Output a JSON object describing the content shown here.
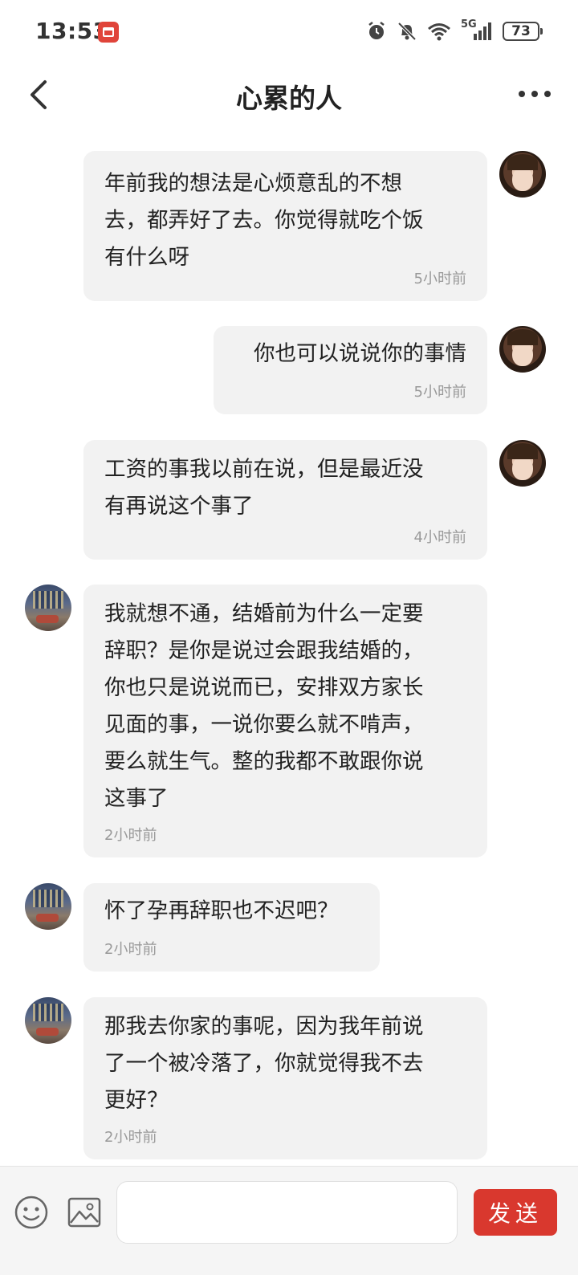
{
  "status_bar": {
    "time": "13:53",
    "network_label": "5G",
    "battery_level": "73",
    "icons": [
      "app-badge-icon",
      "alarm-icon",
      "mute-bell-icon",
      "wifi-icon",
      "signal-icon",
      "battery-icon"
    ]
  },
  "header": {
    "title": "心累的人",
    "back_icon": "chevron-left-icon",
    "more_icon": "more-dots-icon"
  },
  "messages": [
    {
      "sender": "me",
      "text": "年前我的想法是心烦意乱的不想\n去，都弄好了去。你觉得就吃个饭\n有什么呀",
      "time": "5小时前"
    },
    {
      "sender": "me",
      "text": "你也可以说说你的事情",
      "time": "5小时前"
    },
    {
      "sender": "me",
      "text": "工资的事我以前在说，但是最近没\n有再说这个事了",
      "time": "4小时前"
    },
    {
      "sender": "other",
      "text": "我就想不通，结婚前为什么一定要\n辞职？是你是说过会跟我结婚的，\n你也只是说说而已，安排双方家长\n见面的事，一说你要么就不啃声，\n要么就生气。整的我都不敢跟你说\n这事了",
      "time": "2小时前"
    },
    {
      "sender": "other",
      "text": "怀了孕再辞职也不迟吧？",
      "time": "2小时前"
    },
    {
      "sender": "other",
      "text": "那我去你家的事呢，因为我年前说\n了一个被冷落了，你就觉得我不去\n更好？",
      "time": "2小时前"
    }
  ],
  "input_bar": {
    "emoji_icon": "emoji-icon",
    "image_icon": "image-icon",
    "input_value": "",
    "input_placeholder": "",
    "send_label": "发送",
    "send_color": "#d9382e"
  },
  "colors": {
    "bubble_bg": "#f2f2f2",
    "time_text": "#999999",
    "accent": "#d9382e"
  }
}
